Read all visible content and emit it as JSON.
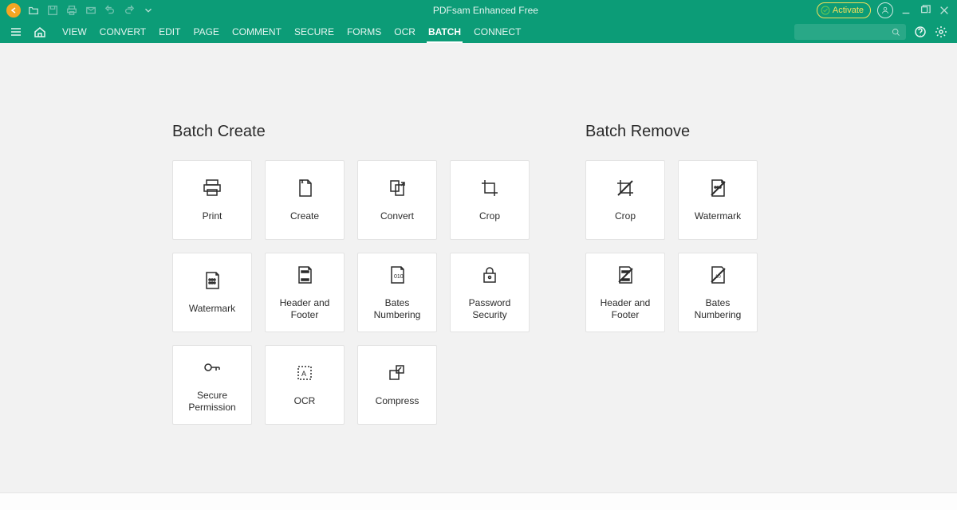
{
  "titlebar": {
    "app_title": "PDFsam Enhanced Free",
    "activate_label": "Activate"
  },
  "menubar": {
    "items": [
      "VIEW",
      "CONVERT",
      "EDIT",
      "PAGE",
      "COMMENT",
      "SECURE",
      "FORMS",
      "OCR",
      "BATCH",
      "CONNECT"
    ],
    "active_index": 8
  },
  "sections": {
    "create": {
      "title": "Batch Create",
      "cards": [
        {
          "label": "Print",
          "icon": "print"
        },
        {
          "label": "Create",
          "icon": "create"
        },
        {
          "label": "Convert",
          "icon": "convert"
        },
        {
          "label": "Crop",
          "icon": "crop"
        },
        {
          "label": "Watermark",
          "icon": "watermark"
        },
        {
          "label": "Header and Footer",
          "icon": "headerfooter"
        },
        {
          "label": "Bates Numbering",
          "icon": "bates"
        },
        {
          "label": "Password Security",
          "icon": "password"
        },
        {
          "label": "Secure Permission",
          "icon": "permission"
        },
        {
          "label": "OCR",
          "icon": "ocr"
        },
        {
          "label": "Compress",
          "icon": "compress"
        }
      ]
    },
    "remove": {
      "title": "Batch Remove",
      "cards": [
        {
          "label": "Crop",
          "icon": "crop-remove"
        },
        {
          "label": "Watermark",
          "icon": "watermark-remove"
        },
        {
          "label": "Header and Footer",
          "icon": "headerfooter-remove"
        },
        {
          "label": "Bates Numbering",
          "icon": "bates-remove"
        }
      ]
    }
  }
}
